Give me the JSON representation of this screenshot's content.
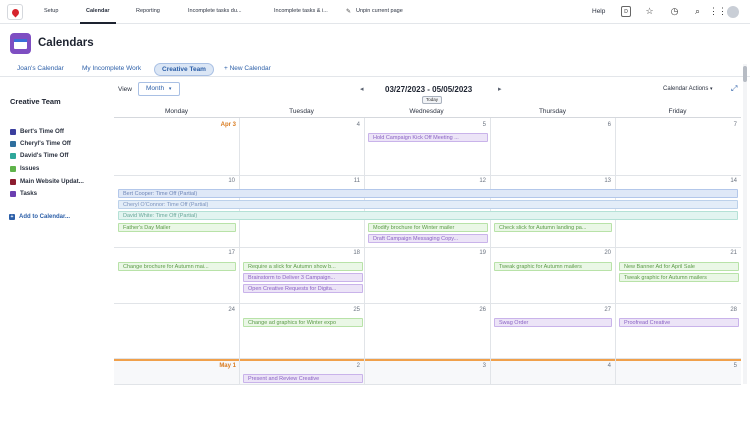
{
  "nav": {
    "items": [
      "Setup",
      "Calendar",
      "Reporting",
      "Incomplete tasks du...",
      "Incomplete tasks & i...",
      "Unpin current page"
    ],
    "active": "Calendar",
    "help": "Help"
  },
  "header": {
    "title": "Calendars"
  },
  "tabs": [
    "Joan's Calendar",
    "My Incomplete Work",
    "Creative Team",
    "+ New Calendar"
  ],
  "sidebar": {
    "title": "Creative Team",
    "calendars": [
      {
        "label": "Bert's Time Off",
        "color": "#3b3f9e"
      },
      {
        "label": "Cheryl's Time Off",
        "color": "#2f6f9e"
      },
      {
        "label": "David's Time Off",
        "color": "#2ea79a"
      },
      {
        "label": "Issues",
        "color": "#5fb34a"
      },
      {
        "label": "Main Website Updat...",
        "color": "#8c1d2f"
      },
      {
        "label": "Tasks",
        "color": "#6b3fb0"
      }
    ],
    "add": "Add to Calendar..."
  },
  "toolbar": {
    "view_label": "View",
    "view_value": "Month",
    "date_range": "03/27/2023 - 05/05/2023",
    "today": "Today",
    "actions": "Calendar Actions"
  },
  "days_of_week": [
    "Monday",
    "Tuesday",
    "Wednesday",
    "Thursday",
    "Friday"
  ],
  "weeks": [
    {
      "days": [
        "Apr 3",
        "4",
        "5",
        "6",
        "7"
      ]
    },
    {
      "days": [
        "10",
        "11",
        "12",
        "13",
        "14"
      ]
    },
    {
      "days": [
        "17",
        "18",
        "19",
        "20",
        "21"
      ]
    },
    {
      "days": [
        "24",
        "25",
        "26",
        "27",
        "28"
      ]
    },
    {
      "days": [
        "May 1",
        "2",
        "3",
        "4",
        "5"
      ]
    }
  ],
  "events": {
    "w1_wed": "Hold Campaign Kick Off Meeting ...",
    "w2_span1": "Bert Cooper: Time Off (Partial)",
    "w2_span2": "Cheryl O'Connor: Time Off (Partial)",
    "w2_span3": "David White: Time Off (Partial)",
    "w2_mon": "Father's Day Mailer",
    "w2_wed1": "Modify brochure for Winter mailer",
    "w2_wed2": "Draft Campaign Messaging Copy...",
    "w2_thu": "Check slick for Autumn landing pa...",
    "w3_mon": "Change brochure for Autumn mai...",
    "w3_tue1": "Require a slick for Autumn show b...",
    "w3_tue2": "Brainstorm to Deliver 3 Campaign...",
    "w3_tue3": "Open Creative Requests for Digita...",
    "w3_thu": "Tweak graphic for Autumn mailers",
    "w3_fri1": "New Banner Ad for April Sale",
    "w3_fri2": "Tweak graphic for Autumn mailers",
    "w4_tue": "Change ad graphics for Winter expo",
    "w4_thu": "Swag Order",
    "w4_fri": "Proofread Creative",
    "w5_tue": "Present and Review Creative"
  }
}
